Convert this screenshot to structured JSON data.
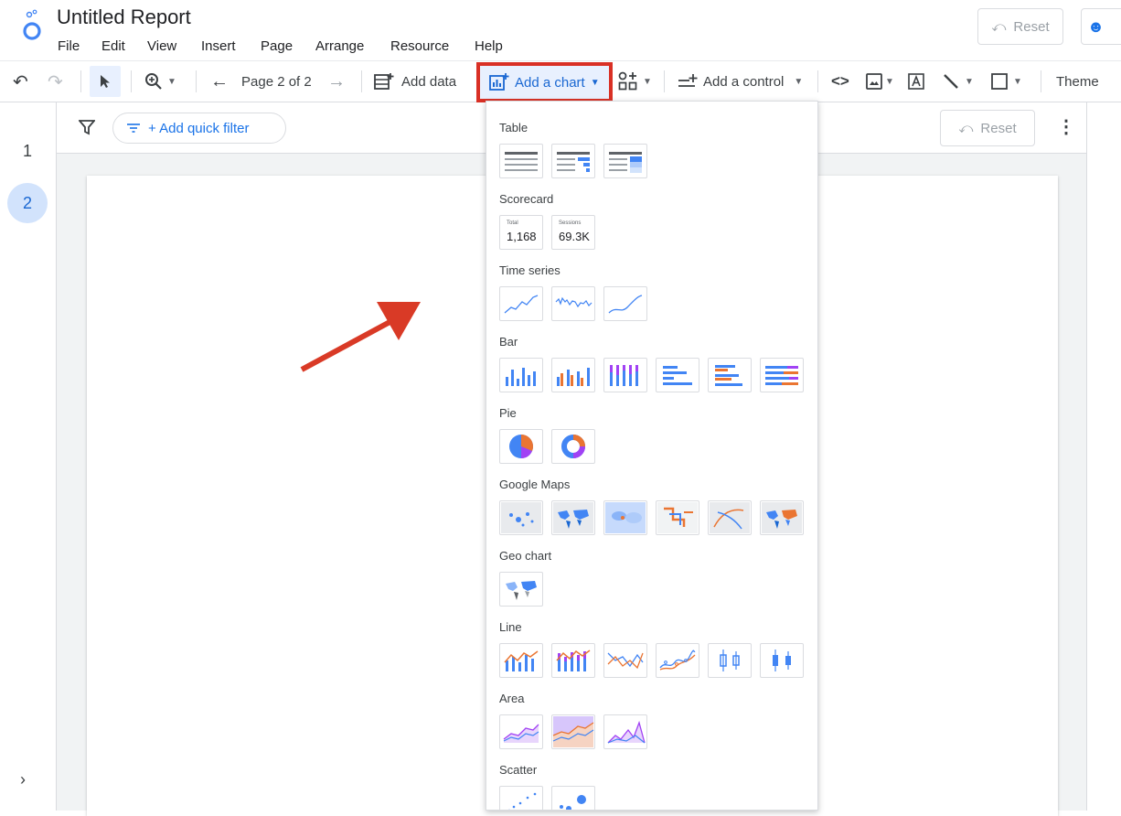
{
  "header": {
    "title": "Untitled Report",
    "menus": [
      "File",
      "Edit",
      "View",
      "Insert",
      "Page",
      "Arrange",
      "Resource",
      "Help"
    ],
    "reset_label": "Reset"
  },
  "toolbar": {
    "page_label": "Page 2 of 2",
    "add_data_label": "Add data",
    "add_chart_label": "Add a chart",
    "add_control_label": "Add a control",
    "theme_label": "Theme"
  },
  "rail": {
    "pages": [
      "1",
      "2"
    ],
    "active_page": "2"
  },
  "filter_bar": {
    "quick_filter_label": "+ Add quick filter",
    "reset_label": "Reset"
  },
  "chart_menu": {
    "sections": [
      "Table",
      "Scorecard",
      "Time series",
      "Bar",
      "Pie",
      "Google Maps",
      "Geo chart",
      "Line",
      "Area",
      "Scatter"
    ],
    "scorecards": [
      {
        "label": "Total",
        "value": "1,168"
      },
      {
        "label": "Sessions",
        "value": "69.3K"
      }
    ]
  },
  "colors": {
    "blue": "#4285f4",
    "orange": "#ea7532",
    "purple": "#a142f4",
    "highlight": "#d93025",
    "arrow": "#d93a26"
  }
}
